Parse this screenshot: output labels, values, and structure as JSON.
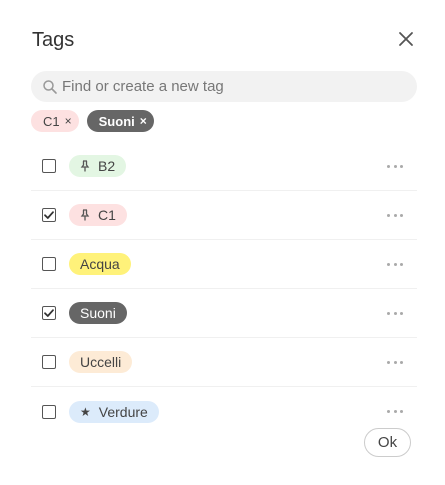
{
  "dialog": {
    "title": "Tags"
  },
  "search": {
    "placeholder": "Find or create a new tag",
    "value": ""
  },
  "selected_tags": [
    {
      "label": "C1",
      "bg": "#fde1e1",
      "fg": "#444444"
    },
    {
      "label": "Suoni",
      "bg": "#666666",
      "fg": "#ffffff"
    }
  ],
  "tags": [
    {
      "label": "B2",
      "checked": false,
      "icon": "pin-icon",
      "bg": "#e3f6e3"
    },
    {
      "label": "C1",
      "checked": true,
      "icon": "pin-icon",
      "bg": "#fde1e1"
    },
    {
      "label": "Acqua",
      "checked": false,
      "icon": "",
      "bg": "#fff27a"
    },
    {
      "label": "Suoni",
      "checked": true,
      "icon": "",
      "bg": "#666666",
      "fg": "#ffffff"
    },
    {
      "label": "Uccelli",
      "checked": false,
      "icon": "",
      "bg": "#fdebd6"
    },
    {
      "label": "Verdure",
      "checked": false,
      "icon": "star-icon",
      "bg": "#dcebfb"
    }
  ],
  "ok_label": "Ok"
}
